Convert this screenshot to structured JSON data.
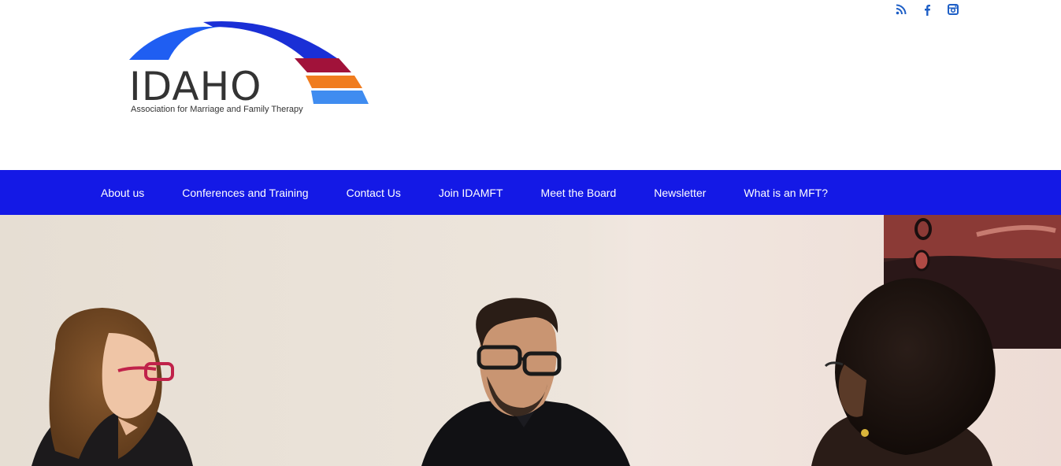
{
  "brand": {
    "logo_word": "IDAHO",
    "logo_tagline": "Association for Marriage and Family Therapy",
    "colors": {
      "arc_blue": "#1f5ef2",
      "arc_dark_blue": "#1a2fd6",
      "arc_red": "#a1123a",
      "arc_orange": "#f07c1e",
      "arc_light_blue": "#3f8cf0",
      "nav_blue": "#1419e6"
    }
  },
  "social": {
    "icons": [
      "rss-icon",
      "facebook-icon",
      "instagram-icon"
    ]
  },
  "nav": {
    "items": [
      {
        "label": "About us"
      },
      {
        "label": "Conferences and Training"
      },
      {
        "label": "Contact Us"
      },
      {
        "label": "Join IDAMFT"
      },
      {
        "label": "Meet the Board"
      },
      {
        "label": "Newsletter"
      },
      {
        "label": "What is an MFT?"
      }
    ]
  },
  "hero": {
    "image": "three-people-therapy-session-photo"
  }
}
